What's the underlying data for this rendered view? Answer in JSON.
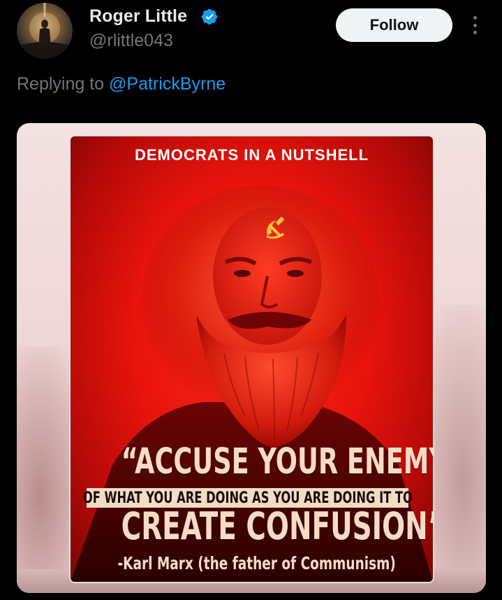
{
  "user": {
    "display_name": "Roger Little",
    "handle": "@rlittle043",
    "verified": true
  },
  "actions": {
    "follow_label": "Follow",
    "more_icon": "more-vertical-icon"
  },
  "reply": {
    "prefix": "Replying to ",
    "mention": "@PatrickByrne"
  },
  "media": {
    "header": "DEMOCRATS IN A NUTSHELL",
    "quote_line1": "“ACCUSE YOUR ENEMY",
    "quote_line2": "OF WHAT YOU ARE DOING AS YOU ARE DOING IT TO",
    "quote_line3": "CREATE CONFUSION”",
    "attribution": "-Karl Marx (the father of Communism)",
    "symbol_icon": "hammer-and-sickle-icon"
  },
  "colors": {
    "background": "#000000",
    "text_primary": "#e7e9ea",
    "text_secondary": "#71767b",
    "link": "#1d9bf0",
    "verified": "#1d9bf0",
    "follow_bg": "#eff3f4",
    "poster_red": "#e8140c"
  }
}
